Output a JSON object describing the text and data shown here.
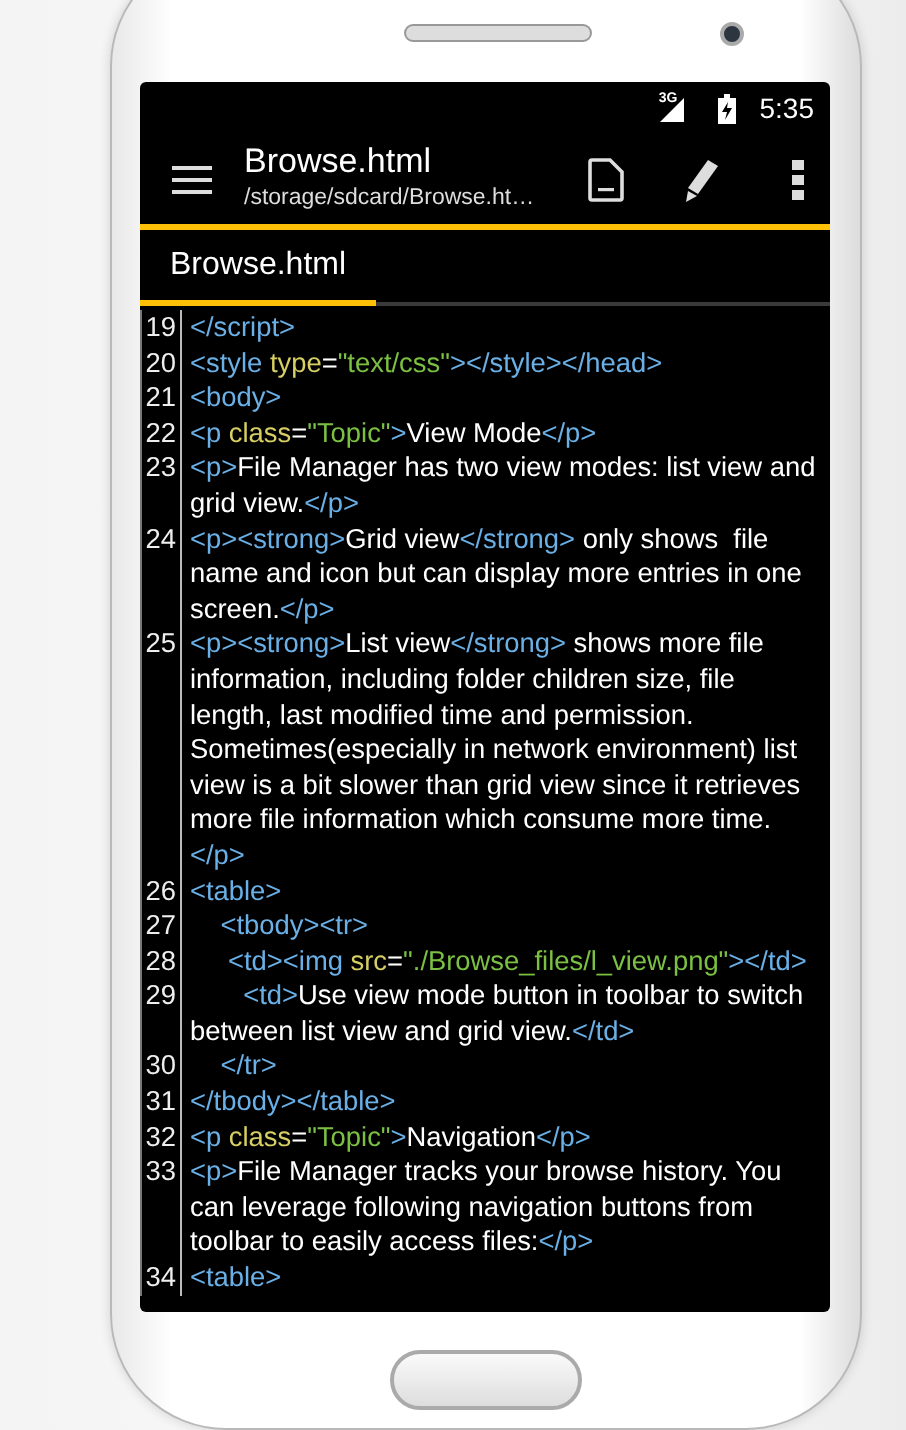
{
  "status_bar": {
    "network": "3G",
    "time": "5:35"
  },
  "toolbar": {
    "title": "Browse.html",
    "subtitle": "/storage/sdcard/Browse.ht…"
  },
  "tabs": [
    {
      "label": "Browse.html",
      "selected": true
    }
  ],
  "code_lines": [
    {
      "number": "19",
      "tokens": [
        {
          "kind": "tag",
          "text": "</script>"
        }
      ]
    },
    {
      "number": "20",
      "tokens": [
        {
          "kind": "tag",
          "text": "<style"
        },
        {
          "kind": "attr",
          "text": " type"
        },
        {
          "kind": "text",
          "text": "="
        },
        {
          "kind": "string",
          "text": "\"text/css\""
        },
        {
          "kind": "tag",
          "text": "></style></head>"
        }
      ]
    },
    {
      "number": "21",
      "tokens": [
        {
          "kind": "tag",
          "text": "<body>"
        }
      ]
    },
    {
      "number": "22",
      "tokens": [
        {
          "kind": "tag",
          "text": "<p"
        },
        {
          "kind": "attr",
          "text": " class"
        },
        {
          "kind": "text",
          "text": "="
        },
        {
          "kind": "string",
          "text": "\"Topic\""
        },
        {
          "kind": "tag",
          "text": ">"
        },
        {
          "kind": "text",
          "text": "View Mode"
        },
        {
          "kind": "tag",
          "text": "</p>"
        }
      ]
    },
    {
      "number": "23",
      "tokens": [
        {
          "kind": "tag",
          "text": "<p>"
        },
        {
          "kind": "text",
          "text": "File Manager has two view modes: list view and grid view."
        },
        {
          "kind": "tag",
          "text": "</p>"
        }
      ]
    },
    {
      "number": "24",
      "tokens": [
        {
          "kind": "tag",
          "text": "<p><strong>"
        },
        {
          "kind": "text",
          "text": "Grid view"
        },
        {
          "kind": "tag",
          "text": "</strong>"
        },
        {
          "kind": "text",
          "text": " only shows  file name and icon but can display more entries in one screen."
        },
        {
          "kind": "tag",
          "text": "</p>"
        }
      ]
    },
    {
      "number": "25",
      "tokens": [
        {
          "kind": "tag",
          "text": "<p><strong>"
        },
        {
          "kind": "text",
          "text": "List view"
        },
        {
          "kind": "tag",
          "text": "</strong>"
        },
        {
          "kind": "text",
          "text": " shows more file information, including folder children size, file length, last modified time and permission. Sometimes(especially in network environment) list view is a bit slower than grid view since it retrieves more file information which consume more time. "
        },
        {
          "kind": "tag",
          "text": "</p>"
        }
      ]
    },
    {
      "number": "26",
      "tokens": [
        {
          "kind": "tag",
          "text": "<table>"
        }
      ]
    },
    {
      "number": "27",
      "tokens": [
        {
          "kind": "tag",
          "text": "    <tbody><tr>"
        }
      ]
    },
    {
      "number": "28",
      "tokens": [
        {
          "kind": "tag",
          "text": "     <td><img"
        },
        {
          "kind": "attr",
          "text": " src"
        },
        {
          "kind": "text",
          "text": "="
        },
        {
          "kind": "string",
          "text": "\"./Browse_files/l_view.png\""
        },
        {
          "kind": "tag",
          "text": "></td>"
        }
      ]
    },
    {
      "number": "29",
      "tokens": [
        {
          "kind": "tag",
          "text": "       <td>"
        },
        {
          "kind": "text",
          "text": "Use view mode button in toolbar to switch between list view and grid view."
        },
        {
          "kind": "tag",
          "text": "</td>"
        }
      ]
    },
    {
      "number": "30",
      "tokens": [
        {
          "kind": "tag",
          "text": "    </tr>"
        }
      ]
    },
    {
      "number": "31",
      "tokens": [
        {
          "kind": "tag",
          "text": "</tbody></table>"
        }
      ]
    },
    {
      "number": "32",
      "tokens": [
        {
          "kind": "tag",
          "text": "<p"
        },
        {
          "kind": "attr",
          "text": " class"
        },
        {
          "kind": "text",
          "text": "="
        },
        {
          "kind": "string",
          "text": "\"Topic\""
        },
        {
          "kind": "tag",
          "text": ">"
        },
        {
          "kind": "text",
          "text": "Navigation"
        },
        {
          "kind": "tag",
          "text": "</p>"
        }
      ]
    },
    {
      "number": "33",
      "tokens": [
        {
          "kind": "tag",
          "text": "<p>"
        },
        {
          "kind": "text",
          "text": "File Manager tracks your browse history. You can leverage following navigation buttons from toolbar to easily access files:"
        },
        {
          "kind": "tag",
          "text": "</p>"
        }
      ]
    },
    {
      "number": "34",
      "tokens": [
        {
          "kind": "tag",
          "text": "<table>"
        }
      ]
    }
  ]
}
